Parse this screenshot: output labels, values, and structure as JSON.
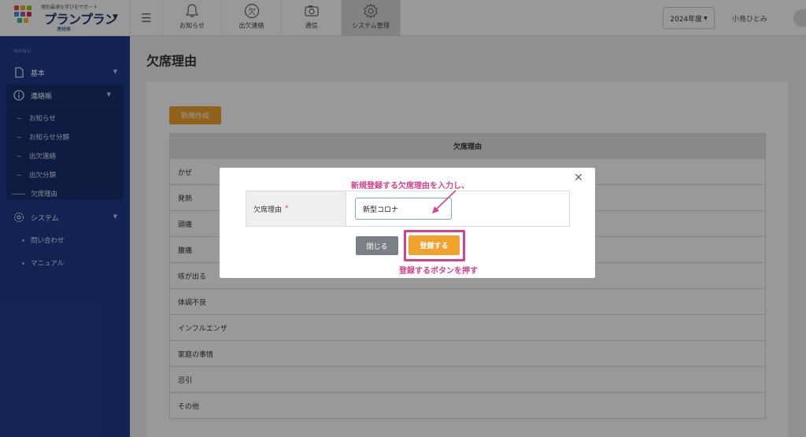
{
  "header": {
    "logo": {
      "tagline": "個別最適な学びをサポート",
      "name": "プランプラン",
      "subtitle": "連絡帳"
    },
    "tabs": [
      {
        "label": "お知らせ",
        "icon": "bell-icon",
        "active": false
      },
      {
        "label": "出欠連絡",
        "icon": "absence-icon",
        "active": false
      },
      {
        "label": "通信",
        "icon": "camera-icon",
        "active": false
      },
      {
        "label": "システム管理",
        "icon": "gear-icon",
        "active": true
      }
    ],
    "year": "2024年度",
    "user_name": "小島ひとみ"
  },
  "sidebar": {
    "caption": "MENU",
    "items": {
      "basic": "基本",
      "contact_book": "連絡帳",
      "system": "システム"
    },
    "contact_sub": [
      "お知らせ",
      "お知らせ分類",
      "出欠連絡",
      "出欠分類",
      "欠席理由"
    ],
    "system_sub": [
      "問い合わせ",
      "マニュアル"
    ]
  },
  "main": {
    "title": "欠席理由",
    "new_button": "新規作成",
    "table_header": "欠席理由",
    "rows": [
      "かぜ",
      "発熱",
      "頭痛",
      "腹痛",
      "咳が出る",
      "体調不良",
      "インフルエンザ",
      "家庭の事情",
      "忌引",
      "その他"
    ]
  },
  "modal": {
    "field_label": "欠席理由",
    "required_mark": "*",
    "field_value": "新型コロナ",
    "close_label": "閉じる",
    "submit_label": "登録する"
  },
  "annotations": {
    "top": "新規登録する欠席理由を入力し、",
    "bottom": "登録するボタンを押す"
  },
  "colors": {
    "sidebar": "#1f3a8a",
    "accent_button": "#f0a22e",
    "annotation": "#d4418e"
  }
}
